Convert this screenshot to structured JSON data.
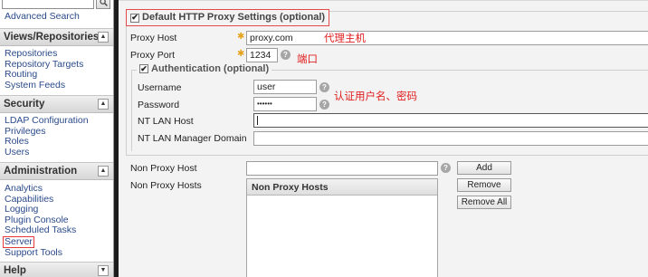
{
  "sidebar": {
    "search": {
      "value": "",
      "button_icon": "search-icon"
    },
    "advanced_search": "Advanced Search",
    "sections": [
      {
        "title": "Views/Repositories",
        "items": [
          "Repositories",
          "Repository Targets",
          "Routing",
          "System Feeds"
        ]
      },
      {
        "title": "Security",
        "items": [
          "LDAP Configuration",
          "Privileges",
          "Roles",
          "Users"
        ]
      },
      {
        "title": "Administration",
        "items": [
          "Analytics",
          "Capabilities",
          "Logging",
          "Plugin Console",
          "Scheduled Tasks",
          "Server",
          "Support Tools"
        ]
      },
      {
        "title": "Help",
        "items": []
      }
    ],
    "highlighted_item": "Server"
  },
  "proxy": {
    "legend": "Default HTTP Proxy Settings (optional)",
    "enabled": true,
    "host_label": "Proxy Host",
    "host_value": "proxy.com",
    "port_label": "Proxy Port",
    "port_value": "1234",
    "auth": {
      "legend": "Authentication (optional)",
      "enabled": true,
      "username_label": "Username",
      "username_value": "user",
      "password_label": "Password",
      "password_value": "••••••",
      "ntlan_host_label": "NT LAN Host",
      "ntlan_host_value": "",
      "ntlan_domain_label": "NT LAN Manager Domain",
      "ntlan_domain_value": ""
    },
    "non_proxy_host_label": "Non Proxy Host",
    "non_proxy_host_value": "",
    "non_proxy_hosts_label": "Non Proxy Hosts",
    "non_proxy_hosts_header": "Non Proxy Hosts",
    "buttons": {
      "add": "Add",
      "remove": "Remove",
      "remove_all": "Remove All"
    }
  },
  "annotations": {
    "host": "代理主机",
    "port": "端口",
    "credentials": "认证用户名、密码"
  },
  "colors": {
    "annotation_red": "#e02020",
    "required_star": "#e6a21a",
    "link_blue": "#2a4a8a"
  }
}
